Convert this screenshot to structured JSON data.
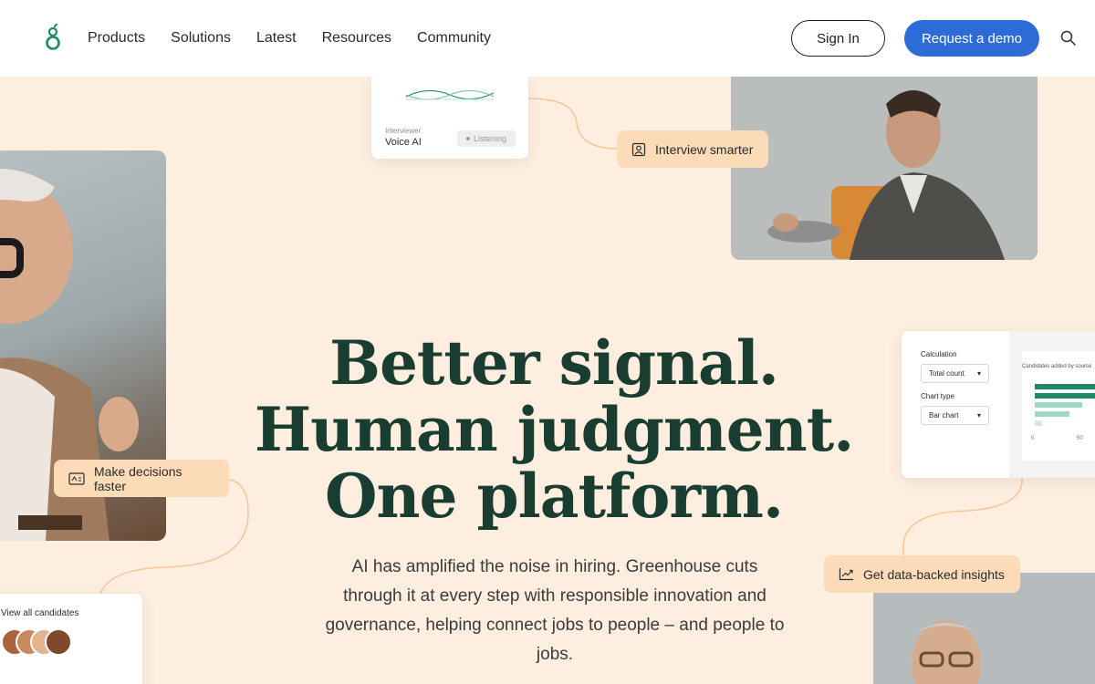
{
  "nav": {
    "logo_alt": "Greenhouse",
    "links": [
      "Products",
      "Solutions",
      "Latest",
      "Resources",
      "Community"
    ],
    "sign_in": "Sign In",
    "request_demo": "Request a demo"
  },
  "hero": {
    "title_lines": [
      "Better signal.",
      "Human judgment.",
      "One platform."
    ],
    "subtitle": "AI has amplified the noise in hiring. Greenhouse cuts through it at every step with responsible innovation and governance, helping connect jobs to people – and people to jobs."
  },
  "cards": {
    "voice": {
      "small_label": "Interviewer",
      "label": "Voice AI",
      "badge": "Listening"
    },
    "calc": {
      "calculation_label": "Calculation",
      "calculation_value": "Total count",
      "chart_type_label": "Chart type",
      "chart_type_value": "Bar chart",
      "chart_title": "Candidates added by source",
      "axis_min": "0",
      "axis_max": "50"
    },
    "candidates": {
      "label": "View all candidates"
    }
  },
  "pills": {
    "interview": "Interview smarter",
    "decide": "Make decisions faster",
    "insights": "Get data-backed insights"
  },
  "colors": {
    "background": "#fdeee0",
    "pill": "#fcdcb8",
    "brand_green": "#193d31",
    "demo_button": "#2d6bd7"
  }
}
